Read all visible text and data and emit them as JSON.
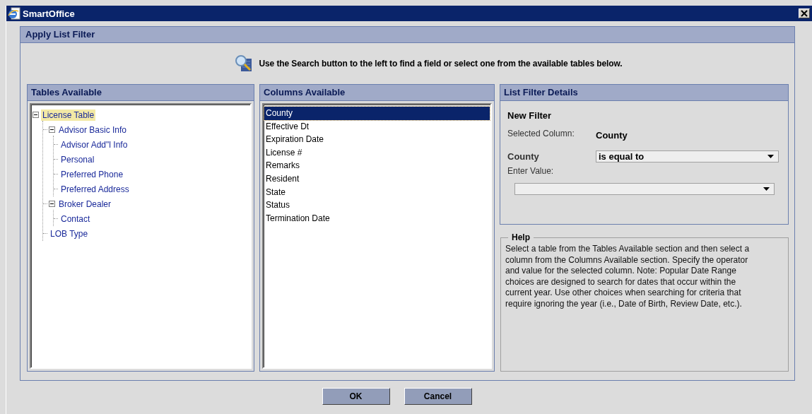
{
  "window": {
    "title": "SmartOffice"
  },
  "dialog": {
    "title": "Apply List Filter",
    "instruction": "Use the Search button to the left to find a field or select one from the available tables below."
  },
  "tables_panel": {
    "title": "Tables Available",
    "tree": [
      {
        "label": "License Table",
        "selected": true,
        "expanded": true,
        "children": [
          {
            "label": "Advisor Basic Info",
            "selected": false,
            "expanded": true,
            "children": [
              {
                "label": "Advisor Add\"l Info",
                "selected": false
              },
              {
                "label": "Personal",
                "selected": false
              },
              {
                "label": "Preferred Phone",
                "selected": false
              },
              {
                "label": "Preferred Address",
                "selected": false
              }
            ]
          },
          {
            "label": "Broker Dealer",
            "selected": false,
            "expanded": true,
            "children": [
              {
                "label": "Contact",
                "selected": false
              }
            ]
          },
          {
            "label": "LOB Type",
            "selected": false
          }
        ]
      }
    ]
  },
  "columns_panel": {
    "title": "Columns Available",
    "items": [
      {
        "label": "County",
        "selected": true
      },
      {
        "label": "Effective Dt",
        "selected": false
      },
      {
        "label": "Expiration Date",
        "selected": false
      },
      {
        "label": "License #",
        "selected": false
      },
      {
        "label": "Remarks",
        "selected": false
      },
      {
        "label": "Resident",
        "selected": false
      },
      {
        "label": "State",
        "selected": false
      },
      {
        "label": "Status",
        "selected": false
      },
      {
        "label": "Termination Date",
        "selected": false
      }
    ]
  },
  "details_panel": {
    "title": "List Filter Details",
    "heading": "New Filter",
    "selected_column_label": "Selected Column:",
    "selected_column_value": "County",
    "operator_label": "County",
    "operator": "is equal to",
    "value_label": "Enter Value:"
  },
  "help": {
    "title": "Help",
    "text": "Select a table from the Tables Available section and then select a column from the Columns Available section. Specify the operator and value for the selected column. Note: Popular Date Range choices are designed to search for dates that occur within the current year. Use other choices when searching for criteria that require ignoring the year (i.e., Date of Birth, Review Date, etc.)."
  },
  "buttons": [
    {
      "label": "OK"
    },
    {
      "label": "Cancel"
    }
  ]
}
